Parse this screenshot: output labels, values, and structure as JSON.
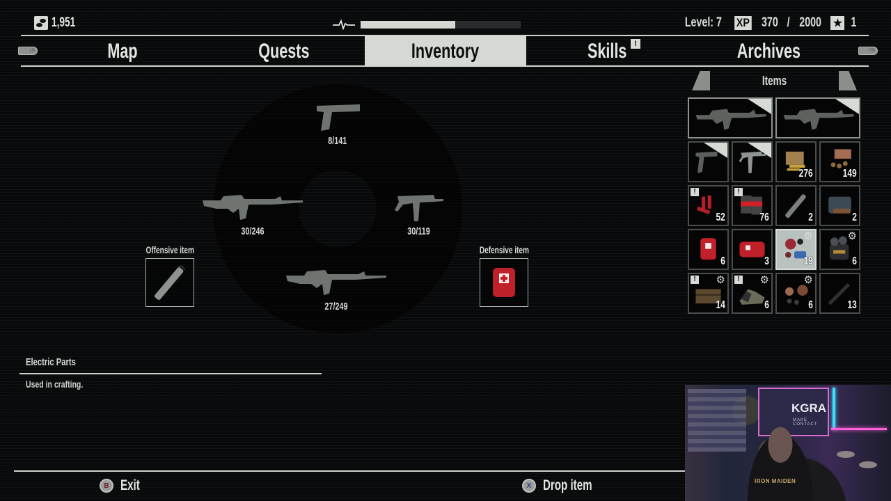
{
  "hud": {
    "money_icon": "coins-icon",
    "money": "1,951",
    "health_icon": "heartbeat-icon",
    "health_fraction": 0.59,
    "level_label": "Level: 7",
    "xp_badge": "XP",
    "xp_current": "370",
    "xp_sep": "/",
    "xp_max": "2000",
    "skill_points_icon": "star-icon",
    "skill_points": "1"
  },
  "tabs": [
    {
      "label": "Map",
      "active": false,
      "alert": false
    },
    {
      "label": "Quests",
      "active": false,
      "alert": false
    },
    {
      "label": "Inventory",
      "active": true,
      "alert": false
    },
    {
      "label": "Skills",
      "active": false,
      "alert": true
    },
    {
      "label": "Archives",
      "active": false,
      "alert": false
    }
  ],
  "bumpers": {
    "left": "LB",
    "right": "RB"
  },
  "alert_glyph": "!",
  "weapon_wheel": {
    "top": {
      "weapon": "pistol",
      "ammo": "8/141"
    },
    "left": {
      "weapon": "assault-rifle",
      "ammo": "30/246"
    },
    "right": {
      "weapon": "submachine-gun",
      "ammo": "30/119"
    },
    "bottom": {
      "weapon": "assault-rifle",
      "ammo": "27/249"
    }
  },
  "offensive_slot": {
    "label": "Offensive item",
    "item": "pipe-bomb"
  },
  "defensive_slot": {
    "label": "Defensive item",
    "item": "first-aid-kit"
  },
  "items_panel": {
    "title": "Items",
    "left_trigger": "LT",
    "right_trigger": "RT",
    "cells": [
      {
        "item": "assault-rifle",
        "qty": "",
        "equipped": true,
        "new": false,
        "craft": false,
        "wide": true,
        "selected": false
      },
      {
        "item": "assault-rifle",
        "qty": "",
        "equipped": true,
        "new": false,
        "craft": false,
        "wide": true,
        "selected": false
      },
      {
        "item": "pistol",
        "qty": "",
        "equipped": true,
        "new": false,
        "craft": false,
        "wide": false,
        "selected": false
      },
      {
        "item": "submachine-gun",
        "qty": "",
        "equipped": true,
        "new": false,
        "craft": false,
        "wide": false,
        "selected": false
      },
      {
        "item": "rifle-ammo",
        "qty": "276",
        "equipped": false,
        "new": false,
        "craft": false,
        "wide": false,
        "selected": false
      },
      {
        "item": "pistol-ammo",
        "qty": "149",
        "equipped": false,
        "new": false,
        "craft": false,
        "wide": false,
        "selected": false
      },
      {
        "item": "shotgun-shells",
        "qty": "52",
        "equipped": false,
        "new": true,
        "craft": false,
        "wide": false,
        "selected": false
      },
      {
        "item": "smg-ammo",
        "qty": "76",
        "equipped": false,
        "new": true,
        "craft": false,
        "wide": false,
        "selected": false
      },
      {
        "item": "pipe-bomb",
        "qty": "2",
        "equipped": false,
        "new": false,
        "craft": false,
        "wide": false,
        "selected": false
      },
      {
        "item": "satchel-charge",
        "qty": "2",
        "equipped": false,
        "new": false,
        "craft": false,
        "wide": false,
        "selected": false
      },
      {
        "item": "first-aid-kit",
        "qty": "6",
        "equipped": false,
        "new": false,
        "craft": false,
        "wide": false,
        "selected": false
      },
      {
        "item": "medical-bag",
        "qty": "3",
        "equipped": false,
        "new": false,
        "craft": false,
        "wide": false,
        "selected": false
      },
      {
        "item": "electric-parts",
        "qty": "19",
        "equipped": false,
        "new": false,
        "craft": true,
        "wide": false,
        "selected": true
      },
      {
        "item": "mechanical-parts",
        "qty": "6",
        "equipped": false,
        "new": false,
        "craft": true,
        "wide": false,
        "selected": false
      },
      {
        "item": "wood-crate",
        "qty": "14",
        "equipped": false,
        "new": true,
        "craft": true,
        "wide": false,
        "selected": false
      },
      {
        "item": "cloth",
        "qty": "6",
        "equipped": false,
        "new": true,
        "craft": true,
        "wide": false,
        "selected": false
      },
      {
        "item": "scrap-metal",
        "qty": "6",
        "equipped": false,
        "new": false,
        "craft": true,
        "wide": false,
        "selected": false
      },
      {
        "item": "blade",
        "qty": "13",
        "equipped": false,
        "new": false,
        "craft": false,
        "wide": false,
        "selected": false
      }
    ]
  },
  "description": {
    "name": "Electric Parts",
    "text": "Used in crafting."
  },
  "footer": {
    "exit_glyph": "B",
    "exit_label": "Exit",
    "drop_glyph": "X",
    "drop_label": "Drop item"
  },
  "webcam": {
    "poster_title": "KGRA",
    "poster_sub": "MAKE CONTACT",
    "shirt_text": "IRON MAIDEN"
  },
  "colors": {
    "background": "#08090a",
    "foreground": "#d9ddd8",
    "active_tab": "#d4dad3",
    "health_fill": "#d3d9d2",
    "health_track": "#2a2b2c",
    "exit_button": "#9a9c9a",
    "drop_button": "#6b7da8"
  }
}
